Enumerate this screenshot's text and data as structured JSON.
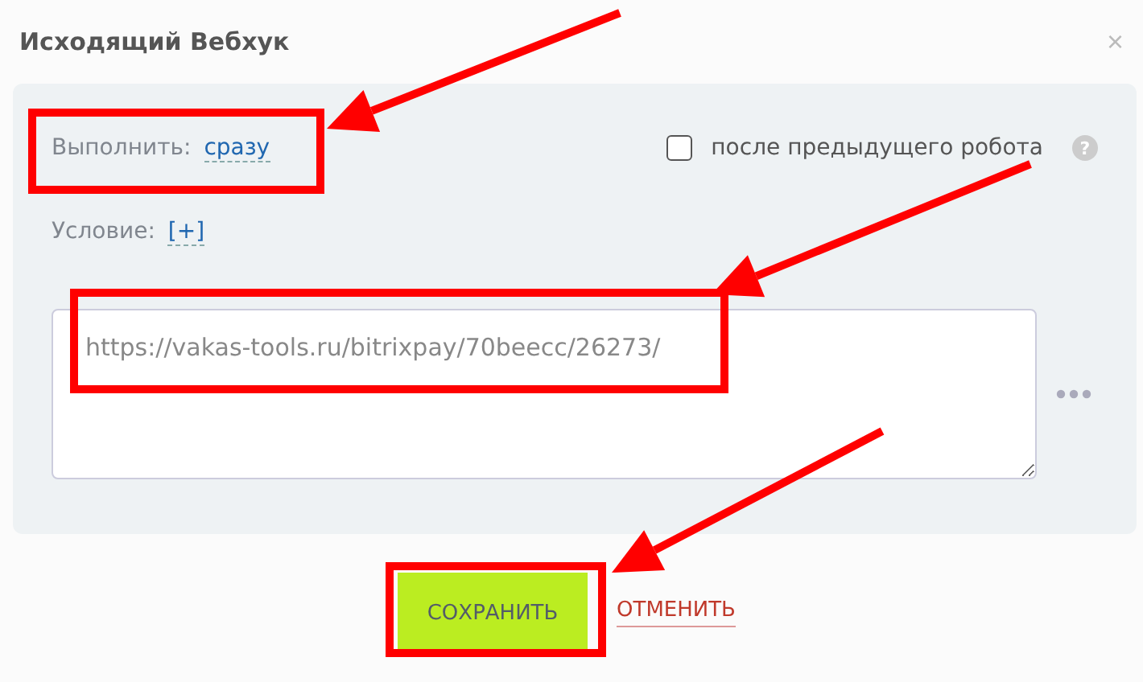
{
  "window": {
    "title": "Исходящий Вебхук",
    "close": "×"
  },
  "execute": {
    "label": "Выполнить:",
    "value": "сразу"
  },
  "after_previous": {
    "label": "после предыдущего робота",
    "checked": false,
    "help": "?"
  },
  "condition": {
    "label": "Условие:",
    "value": "[+]"
  },
  "url_field": {
    "value": "https://vakas-tools.ru/bitrixpay/70beecc/26273/"
  },
  "buttons": [
    {
      "kind": "primary",
      "label": "СОХРАНИТЬ"
    },
    {
      "kind": "link",
      "label": "ОТМЕНИТЬ"
    }
  ]
}
